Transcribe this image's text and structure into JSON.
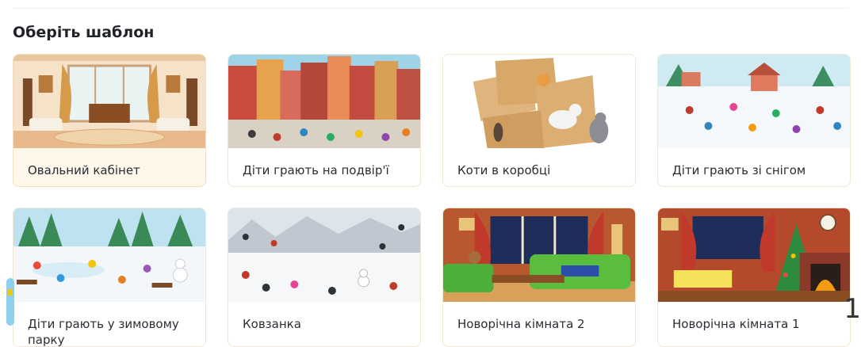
{
  "section": {
    "title": "Оберіть шаблон"
  },
  "templates": [
    {
      "label": "Овальний кабінет"
    },
    {
      "label": "Діти грають на подвір'ї"
    },
    {
      "label": "Коти в коробці"
    },
    {
      "label": "Діти грають зі снігом"
    },
    {
      "label": "Діти грають у зимовому парку"
    },
    {
      "label": "Ковзанка"
    },
    {
      "label": "Новорічна кімната 2"
    },
    {
      "label": "Новорічна кімната 1"
    }
  ],
  "corner_number": "1"
}
